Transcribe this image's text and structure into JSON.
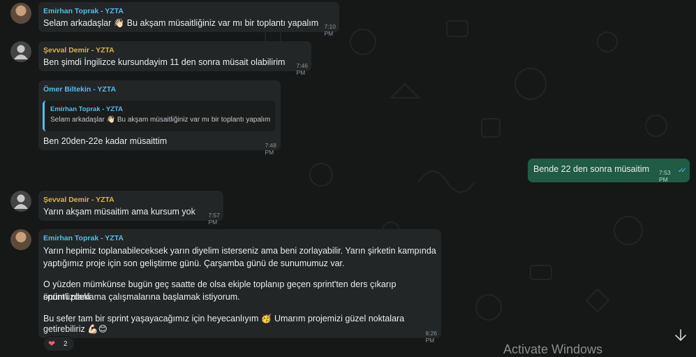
{
  "messages": [
    {
      "sender": "Emirhan Toprak - YZTA",
      "text": "Selam arkadaşlar 👋🏻 Bu akşam müsaitliğiniz var mı bir toplantı yapalım",
      "time": "7:10 PM"
    },
    {
      "sender": "Şevval Demir - YZTA",
      "text": "Ben şimdi İngilizce kursundayim 11 den sonra müsait olabilirim",
      "time": "7:46 PM"
    },
    {
      "sender": "Ömer Biltekin - YZTA",
      "quote": {
        "sender": "Emirhan Toprak - YZTA",
        "text": "Selam arkadaşlar 👋🏻 Bu akşam müsaitliğiniz var mı bir toplantı yapalım"
      },
      "text": "Ben 20den-22e kadar müsaittim",
      "time": "7:48 PM"
    },
    {
      "text": "Bende 22 den sonra müsaitim",
      "time": "7:53 PM",
      "ticks": "✓✓"
    },
    {
      "sender": "Şevval Demir - YZTA",
      "text": "Yarın akşam müsaitim ama kursum yok",
      "time": "7:57 PM"
    },
    {
      "sender": "Emirhan Toprak - YZTA",
      "lines": [
        "Yarın hepimiz toplanabileceksek yarın diyelim isterseniz ama beni zorlayabilir. Yarın şirketin kampında",
        "yaptığımız proje için son geliştirme günü. Çarşamba günü de sunumumuz var.",
        "O yüzden mümkünse bugün geç saatte de olsa ekiple toplanıp geçen sprint'ten ders çıkarıp önümüzdeki",
        "sprint'i planlama çalışmalarına başlamak istiyorum.",
        "Bu sefer tam bir sprint yaşayacağımız için heyecanlıyım 🥳 Umarım projemizi güzel noktalara",
        "getirebiliriz 💪🏻😊"
      ],
      "time": "8:26 PM",
      "reaction": {
        "emoji": "❤",
        "count": "2"
      }
    }
  ],
  "watermark": "Activate Windows",
  "colors": {
    "background": "#161717",
    "incoming_bubble": "#232626",
    "outgoing_bubble": "#1f5b45",
    "sender_blue": "#53bdeb",
    "sender_yellow": "#d9b44a"
  },
  "icons": {
    "avatar_default": "default-avatar-icon",
    "scroll_down": "arrow-down-icon",
    "read_ticks": "double-check-icon"
  }
}
